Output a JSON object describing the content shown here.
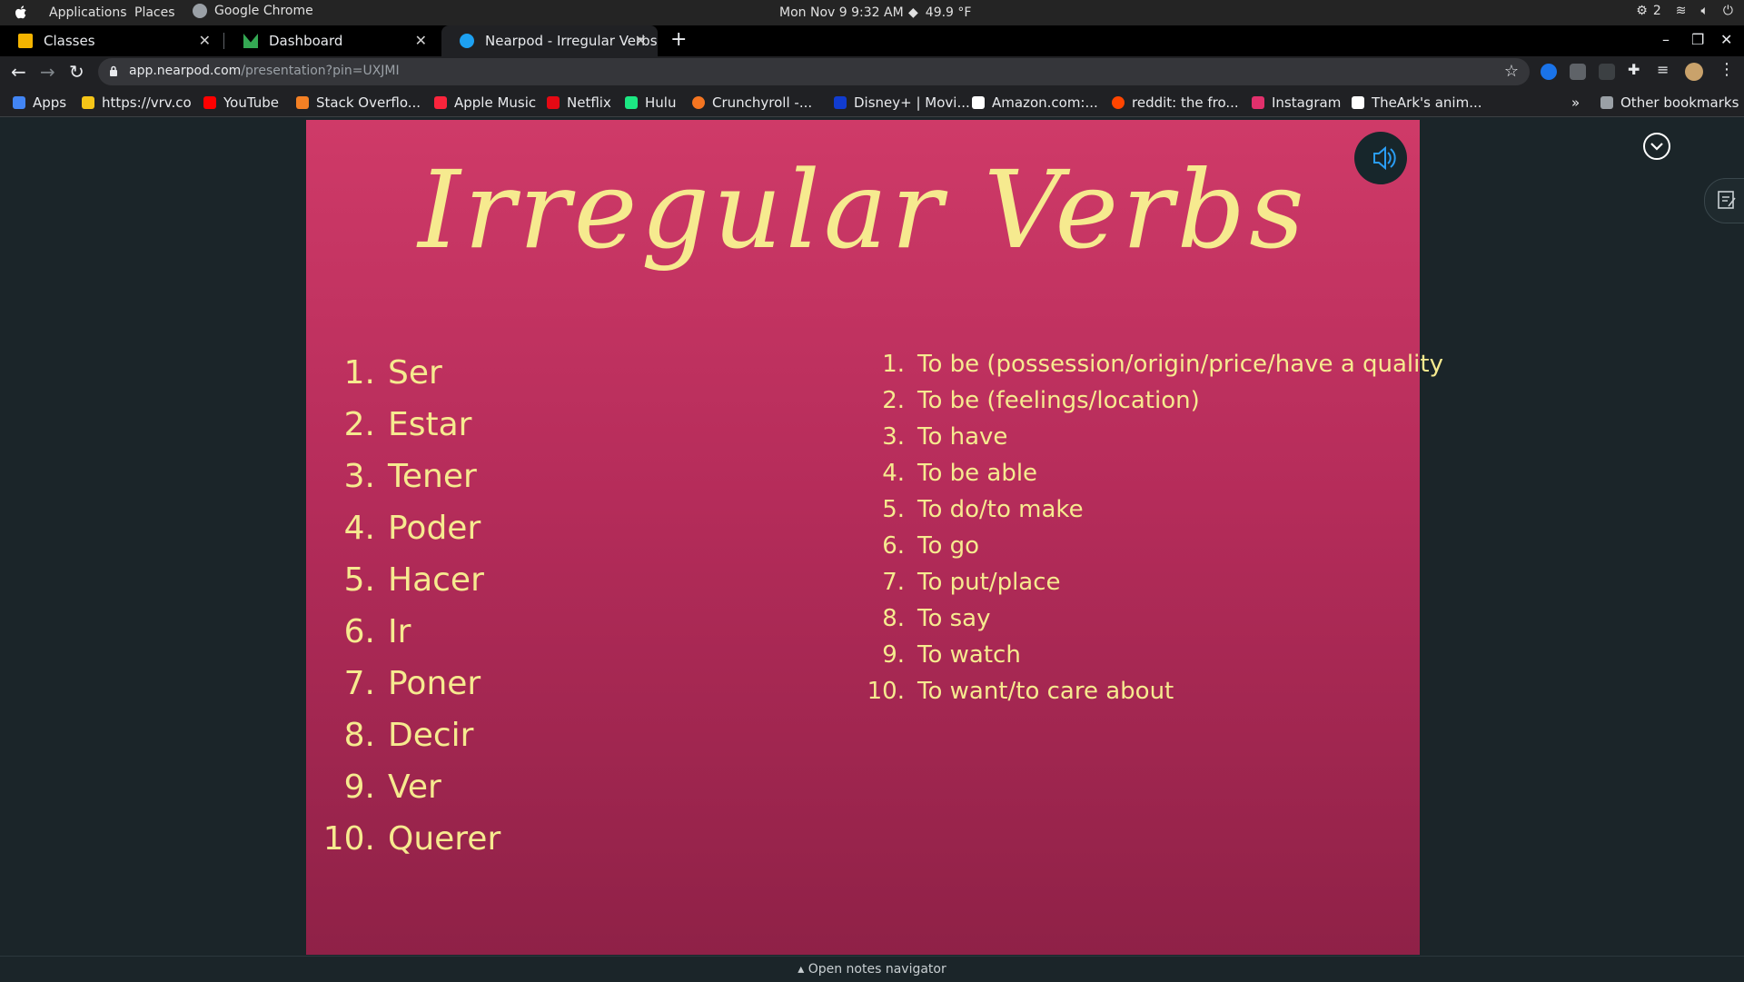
{
  "os": {
    "menu": [
      "Applications",
      "Places",
      "Google Chrome"
    ],
    "clock": "Mon Nov 9   9:32 AM",
    "weather": "49.9 °F",
    "tray_count": "2"
  },
  "tabs": [
    {
      "label": "Classes",
      "icon": "google-classroom-icon",
      "color": "#f4b400"
    },
    {
      "label": "Dashboard",
      "icon": "dashboard-icon",
      "color": "#34a853"
    },
    {
      "label": "Nearpod - Irregular Verbs",
      "icon": "nearpod-icon",
      "color": "#1da1f2"
    }
  ],
  "toolbar": {
    "url_host": "app.nearpod.com",
    "url_path": "/presentation?pin=UXJMI"
  },
  "bookmarks": [
    {
      "label": "Apps",
      "color": "#4285f4"
    },
    {
      "label": "https://vrv.co",
      "color": "#f5c518"
    },
    {
      "label": "YouTube",
      "color": "#ff0000"
    },
    {
      "label": "Stack Overflo...",
      "color": "#f48024"
    },
    {
      "label": "Apple Music",
      "color": "#fa243c"
    },
    {
      "label": "Netflix",
      "color": "#e50914"
    },
    {
      "label": "Hulu",
      "color": "#1ce783"
    },
    {
      "label": "Crunchyroll -...",
      "color": "#f47521"
    },
    {
      "label": "Disney+ | Movi...",
      "color": "#113ccf"
    },
    {
      "label": "Amazon.com:...",
      "color": "#ffffff"
    },
    {
      "label": "reddit: the fro...",
      "color": "#ff4500"
    },
    {
      "label": "Instagram",
      "color": "#e1306c"
    },
    {
      "label": "TheArk's anim...",
      "color": "#ffffff"
    }
  ],
  "other_bookmarks": "Other bookmarks",
  "overflow": "»",
  "slide": {
    "title": "Irregular Verbs",
    "spanish": [
      "Ser",
      "Estar",
      "Tener",
      "Poder",
      "Hacer",
      "Ir",
      "Poner",
      "Decir",
      "Ver",
      "Querer"
    ],
    "numbers": [
      "1.",
      "2.",
      "3.",
      "4.",
      "5.",
      "6.",
      "7.",
      "8.",
      "9.",
      "10."
    ],
    "english": [
      "To be (possession/origin/price/have a quality",
      "To be (feelings/location)",
      "To have",
      "To be able",
      "To do/to make",
      "To go",
      "To put/place",
      "To say",
      "To watch",
      "To want/to care about"
    ]
  },
  "notes_nav": "▴ Open notes navigator"
}
